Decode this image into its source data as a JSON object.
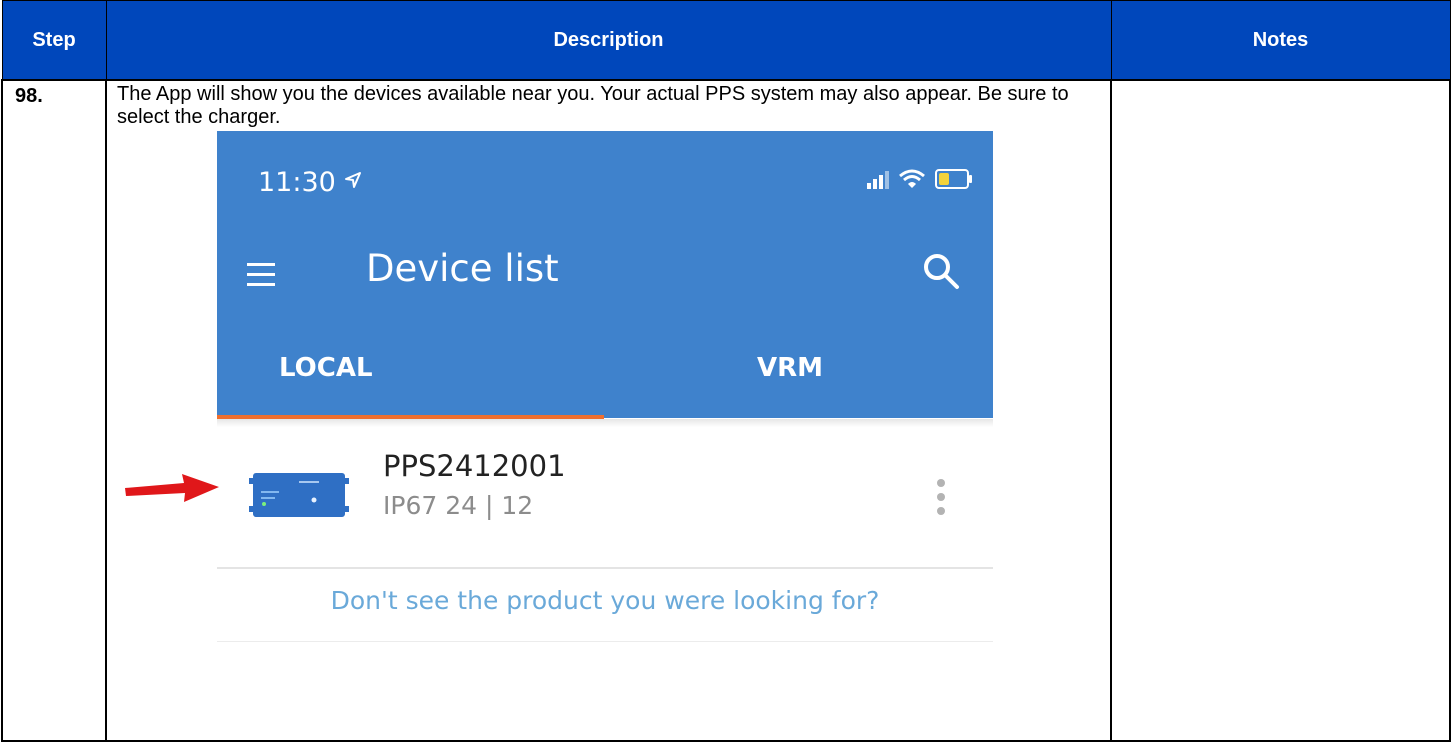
{
  "table": {
    "headers": {
      "step": "Step",
      "description": "Description",
      "notes": "Notes"
    },
    "row": {
      "step": "98.",
      "description": "The App will show you the devices available near you. Your actual PPS system may also appear. Be sure to select the charger.",
      "notes": ""
    }
  },
  "phone": {
    "status_time": "11:30",
    "location_icon": "location-arrow-icon",
    "battery_color": "#f4d33b",
    "app_bar_color": "#3f82cc",
    "title": "Device list",
    "tabs": [
      {
        "label": "LOCAL",
        "selected": true
      },
      {
        "label": "VRM",
        "selected": false
      }
    ],
    "tab_indicator_color": "#ef6f2e",
    "device": {
      "name": "PPS2412001",
      "subtitle": "IP67 24 | 12"
    },
    "not_found_text": "Don't see the product you were looking for?",
    "not_found_color": "#6aa9d9"
  },
  "header_color": "#0047bb",
  "annotation_arrow_color": "#e0171a"
}
